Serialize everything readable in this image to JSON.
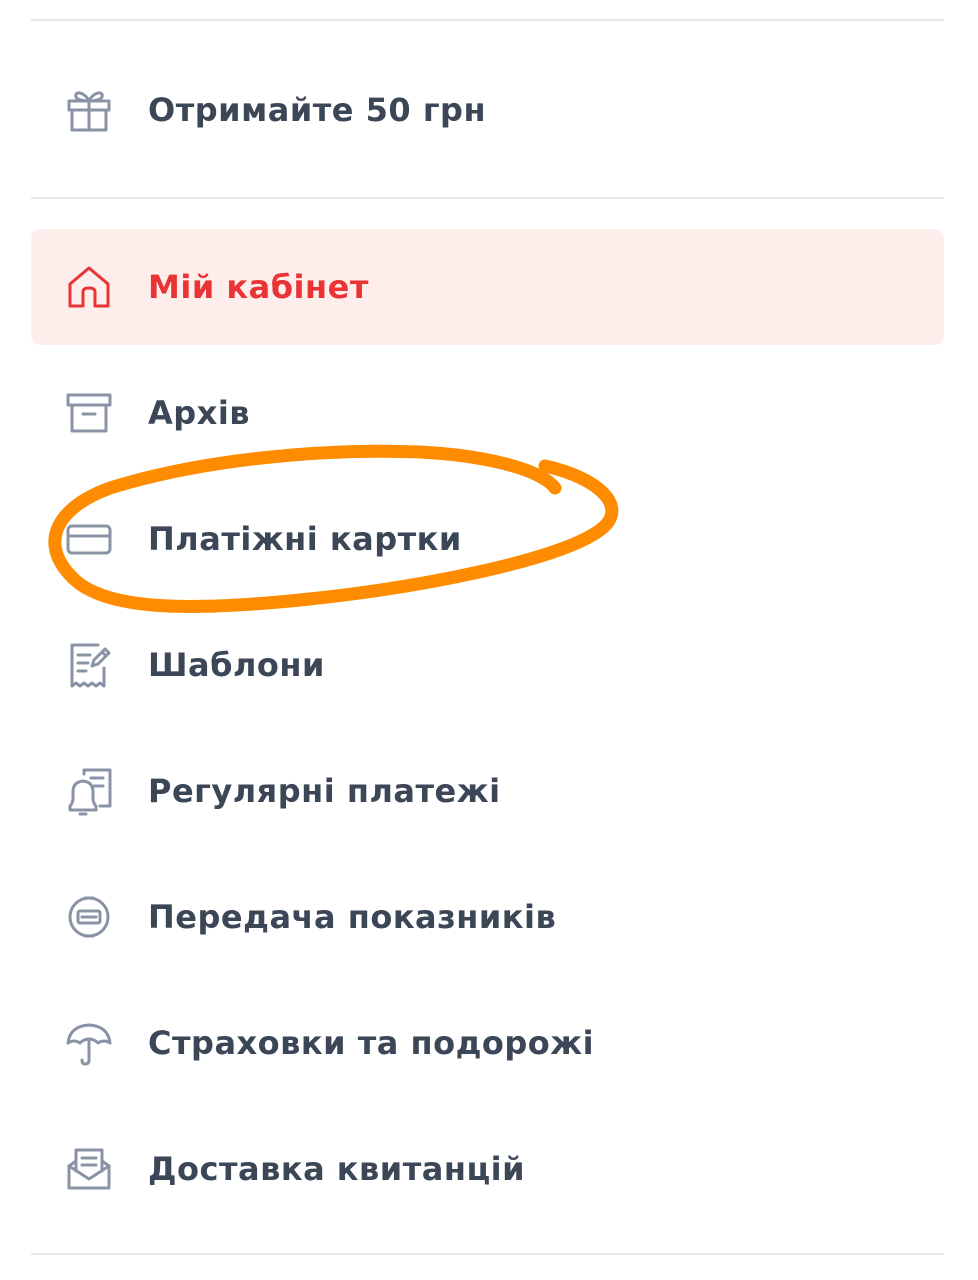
{
  "menu": {
    "promo": {
      "label": "Отримайте 50 грн",
      "icon": "gift-icon"
    },
    "items": [
      {
        "label": "Мій кабінет",
        "icon": "home-icon",
        "active": true
      },
      {
        "label": "Архів",
        "icon": "archive-icon",
        "active": false
      },
      {
        "label": "Платіжні картки",
        "icon": "credit-card-icon",
        "active": false
      },
      {
        "label": "Шаблони",
        "icon": "template-receipt-icon",
        "active": false
      },
      {
        "label": "Регулярні платежі",
        "icon": "recurring-payments-bell-icon",
        "active": false
      },
      {
        "label": "Передача показників",
        "icon": "meter-readings-icon",
        "active": false
      },
      {
        "label": "Страховки та подорожі",
        "icon": "umbrella-icon",
        "active": false
      },
      {
        "label": "Доставка квитанцій",
        "icon": "receipt-delivery-icon",
        "active": false
      }
    ]
  },
  "colors": {
    "active_accent": "#ea3334",
    "active_background": "#fdeeec",
    "label_text": "#3b4657",
    "icon_gray": "#8a93a6",
    "divider": "#e6e8ef",
    "annotation_highlight": "#ff8c00"
  }
}
